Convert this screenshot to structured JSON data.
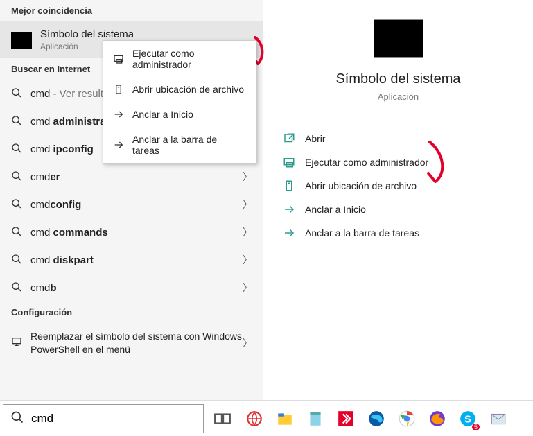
{
  "left": {
    "best_header": "Mejor coincidencia",
    "best_title": "Símbolo del sistema",
    "best_sub": "Aplicación",
    "internet_header": "Buscar en Internet",
    "results": [
      {
        "pre": "cmd",
        "rest": " - Ver resultados web"
      },
      {
        "pre": "cmd ",
        "bold": "administrador"
      },
      {
        "pre": "cmd ",
        "bold": "ipconfig"
      },
      {
        "pre": "cmd",
        "bold": "er"
      },
      {
        "pre": "cmd",
        "bold": "config"
      },
      {
        "pre": "cmd ",
        "bold": "commands"
      },
      {
        "pre": "cmd ",
        "bold": "diskpart"
      },
      {
        "pre": "cmd",
        "bold": "b"
      }
    ],
    "config_header": "Configuración",
    "config_item": "Reemplazar el símbolo del sistema con Windows PowerShell en el menú"
  },
  "ctx": {
    "admin": "Ejecutar como administrador",
    "loc": "Abrir ubicación de archivo",
    "pin_start": "Anclar a Inicio",
    "pin_task": "Anclar a la barra de tareas"
  },
  "right": {
    "title": "Símbolo del sistema",
    "sub": "Aplicación",
    "actions": {
      "open": "Abrir",
      "admin": "Ejecutar como administrador",
      "loc": "Abrir ubicación de archivo",
      "pin_start": "Anclar a Inicio",
      "pin_task": "Anclar a la barra de tareas"
    }
  },
  "search": {
    "value": "cmd"
  }
}
